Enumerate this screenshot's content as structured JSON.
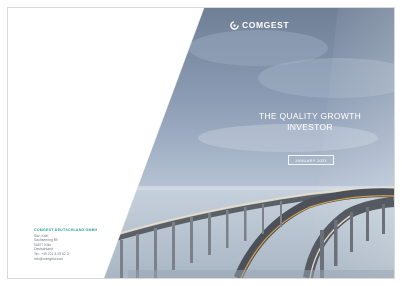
{
  "document": {
    "brand": {
      "name": "COMGEST",
      "logo_icon": "comgest-swirl-icon",
      "color": "#ffffff"
    },
    "headline": {
      "line1": "THE QUALITY GROWTH",
      "line2": "INVESTOR"
    },
    "date_label": "JANUARY 2021",
    "contact": {
      "title": "COMGEST DEUTSCHLAND GMBH",
      "accent_color": "#2aa39a",
      "lines": [
        "Sitz: Köln",
        "Sachsenring 89",
        "50677 Köln",
        "Deutschland",
        "Tel.: +49 221 8 29 62 0",
        "info@comgest.com"
      ]
    }
  }
}
